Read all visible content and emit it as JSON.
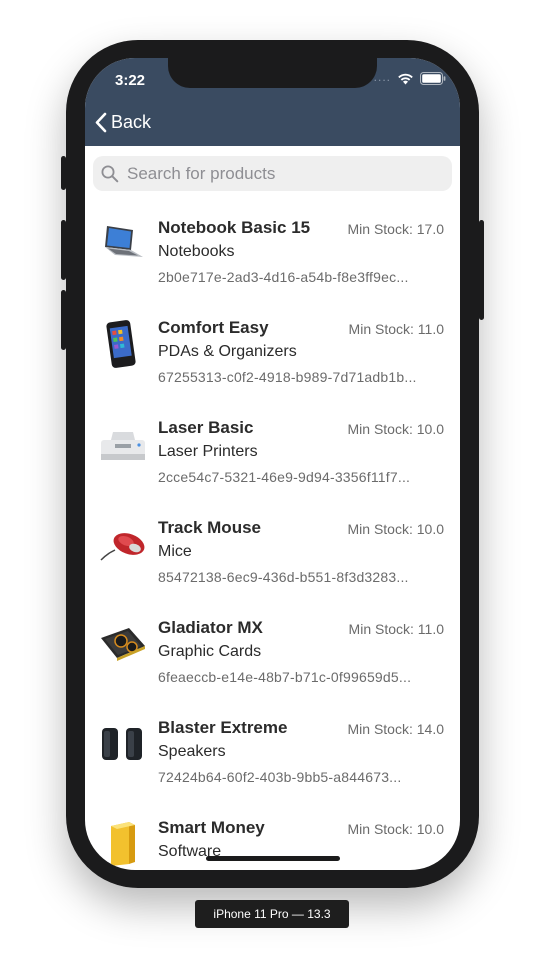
{
  "device": {
    "label": "iPhone 11 Pro — 13.3"
  },
  "status_bar": {
    "time": "3:22",
    "signal_dots": "....",
    "icons": [
      "wifi-icon",
      "battery-icon"
    ]
  },
  "nav": {
    "back_label": "Back"
  },
  "search": {
    "placeholder": "Search for products",
    "value": ""
  },
  "products": [
    {
      "name": "Notebook Basic 15",
      "category": "Notebooks",
      "min_stock": "Min Stock: 17.0",
      "id": "2b0e717e-2ad3-4d16-a54b-f8e3ff9ec...",
      "icon": "notebook-icon"
    },
    {
      "name": "Comfort Easy",
      "category": "PDAs & Organizers",
      "min_stock": "Min Stock: 11.0",
      "id": "67255313-c0f2-4918-b989-7d71adb1b...",
      "icon": "pda-icon"
    },
    {
      "name": "Laser Basic",
      "category": "Laser Printers",
      "min_stock": "Min Stock: 10.0",
      "id": "2cce54c7-5321-46e9-9d94-3356f11f7...",
      "icon": "printer-icon"
    },
    {
      "name": "Track Mouse",
      "category": "Mice",
      "min_stock": "Min Stock: 10.0",
      "id": "85472138-6ec9-436d-b551-8f3d3283...",
      "icon": "mouse-icon"
    },
    {
      "name": "Gladiator MX",
      "category": "Graphic Cards",
      "min_stock": "Min Stock: 11.0",
      "id": "6feaeccb-e14e-48b7-b71c-0f99659d5...",
      "icon": "graphics-card-icon"
    },
    {
      "name": "Blaster Extreme",
      "category": "Speakers",
      "min_stock": "Min Stock: 14.0",
      "id": "72424b64-60f2-403b-9bb5-a844673...",
      "icon": "speakers-icon"
    },
    {
      "name": "Smart Money",
      "category": "Software",
      "min_stock": "Min Stock: 10.0",
      "id": "",
      "icon": "software-box-icon"
    }
  ],
  "colors": {
    "navbar": "#3a4b61",
    "device_frame": "#1b1b1c",
    "search_bg": "#efefef"
  }
}
